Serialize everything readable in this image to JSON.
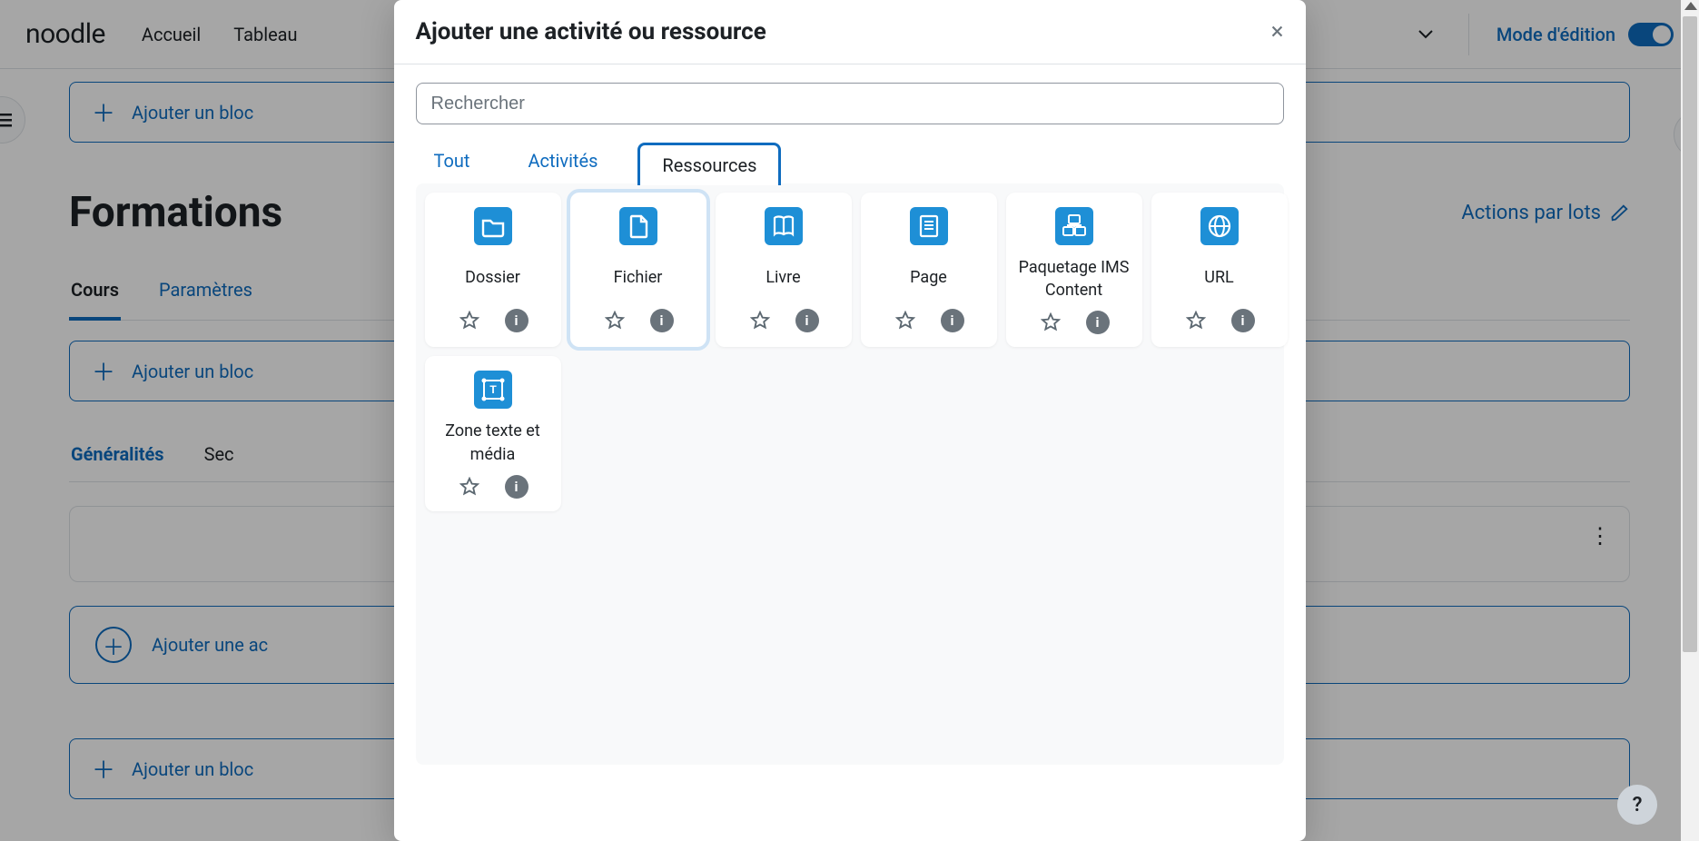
{
  "header": {
    "logo": "noodle",
    "nav": [
      "Accueil",
      "Tableau"
    ],
    "edit_mode_label": "Mode d'édition"
  },
  "page": {
    "add_block": "Ajouter un bloc",
    "title": "Formations",
    "batch_actions": "Actions par lots",
    "tabs": {
      "course": "Cours",
      "settings": "Paramètres"
    },
    "section_tabs": {
      "general": "Généralités",
      "sec": "Sec"
    },
    "add_activity": "Ajouter une ac"
  },
  "modal": {
    "title": "Ajouter une activité ou ressource",
    "search_placeholder": "Rechercher",
    "tabs": {
      "all": "Tout",
      "activities": "Activités",
      "resources": "Ressources"
    },
    "resources": [
      {
        "name": "Dossier",
        "icon": "folder",
        "color": "#1e8fd6"
      },
      {
        "name": "Fichier",
        "icon": "file",
        "color": "#1e8fd6",
        "highlight": true
      },
      {
        "name": "Livre",
        "icon": "book",
        "color": "#1e8fd6"
      },
      {
        "name": "Page",
        "icon": "page",
        "color": "#1e8fd6"
      },
      {
        "name": "Paquetage IMS Content",
        "icon": "ims",
        "color": "#1e8fd6"
      },
      {
        "name": "URL",
        "icon": "globe",
        "color": "#1e8fd6"
      },
      {
        "name": "Zone texte et média",
        "icon": "textmedia",
        "color": "#1e8fd6"
      }
    ]
  },
  "help": {
    "label": "?"
  }
}
